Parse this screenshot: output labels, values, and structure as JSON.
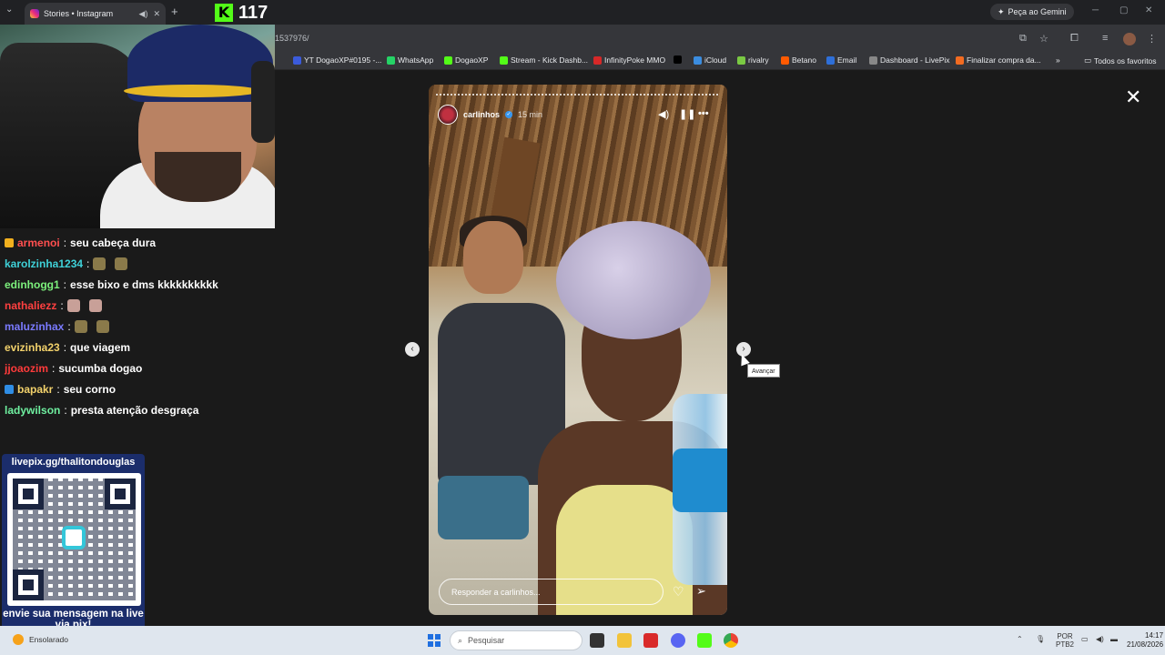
{
  "browser": {
    "tab_title": "Stories • Instagram",
    "url_fragment": "1537976/",
    "gemini_label": "Peça ao Gemini",
    "bookmarks": [
      {
        "label": "YT DogaoXP#0195 -...",
        "color": "#3b5bdb"
      },
      {
        "label": "WhatsApp",
        "color": "#25d366"
      },
      {
        "label": "DogaoXP",
        "color": "#53fc18"
      },
      {
        "label": "Stream - Kick Dashb...",
        "color": "#53fc18"
      },
      {
        "label": "InfinityPoke MMO",
        "color": "#d62828"
      },
      {
        "label": "",
        "color": "#000000"
      },
      {
        "label": "iCloud",
        "color": "#3b8de0"
      },
      {
        "label": "rivalry",
        "color": "#7ac943"
      },
      {
        "label": "Betano",
        "color": "#ff5a00"
      },
      {
        "label": "Email",
        "color": "#2e6fd8"
      },
      {
        "label": "Dashboard - LivePix",
        "color": "#888888"
      },
      {
        "label": "Finalizar compra da...",
        "color": "#f26b21"
      }
    ],
    "all_bookmarks": "Todos os favoritos"
  },
  "story": {
    "username": "carlinhos",
    "time": "15 min",
    "reply_placeholder": "Responder a carlinhos...",
    "tooltip": "Avançar"
  },
  "stream": {
    "viewer_count": "117",
    "chat": [
      {
        "user": "armenoi",
        "color": "#ff4f4f",
        "badge": "#f2b01e",
        "msg": "seu cabeça dura",
        "emotes": 0
      },
      {
        "user": "karolzinha1234",
        "color": "#3fd1d8",
        "badge": "",
        "msg": "",
        "emotes": 2
      },
      {
        "user": "edinhogg1",
        "color": "#7cf07c",
        "badge": "",
        "msg": "esse bixo e dms kkkkkkkkkk",
        "emotes": 0
      },
      {
        "user": "nathaliezz",
        "color": "#ff4040",
        "badge": "",
        "msg": "",
        "emotes": 2
      },
      {
        "user": "maluzinhax",
        "color": "#7a7aff",
        "badge": "",
        "msg": "",
        "emotes": 2
      },
      {
        "user": "evizinha23",
        "color": "#f2d16b",
        "badge": "",
        "msg": "que viagem",
        "emotes": 0
      },
      {
        "user": "jjoaozim",
        "color": "#ff3b3b",
        "badge": "",
        "msg": "sucumba dogao",
        "emotes": 0
      },
      {
        "user": "bapakr",
        "color": "#f2d16b",
        "badge": "#2f8de4",
        "msg": "seu corno",
        "emotes": 0
      },
      {
        "user": "ladywilson",
        "color": "#6ff0a0",
        "badge": "",
        "msg": "presta atenção desgraça",
        "emotes": 0
      }
    ],
    "pix_url": "livepix.gg/thalitondouglas",
    "pix_text": "envie sua mensagem na live via pix!"
  },
  "taskbar": {
    "weather": "Ensolarado",
    "search_placeholder": "Pesquisar",
    "lang": "POR",
    "lang2": "PTB2",
    "time": "14:17",
    "date": "21/08/2026"
  }
}
